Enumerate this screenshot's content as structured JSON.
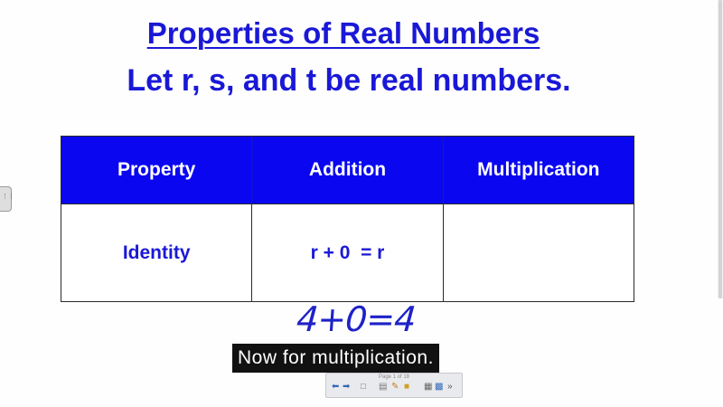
{
  "slide": {
    "title": "Properties of Real Numbers",
    "subtitle": "Let r, s, and t be real numbers."
  },
  "table": {
    "headers": [
      "Property",
      "Addition",
      "Multiplication"
    ],
    "rows": [
      [
        "Identity",
        "r + 0  = r",
        ""
      ]
    ]
  },
  "handwriting": "4+0=4",
  "caption": "Now for multiplication.",
  "toolbar": {
    "page_label": "Page 1 of 18",
    "icons": [
      "back-arrow-icon",
      "forward-arrow-icon",
      "page-icon",
      "table-icon",
      "pen-icon",
      "note-icon",
      "view-icon",
      "screen-icon",
      "more-icon"
    ]
  },
  "colors": {
    "title_blue": "#1a18d6",
    "header_blue": "#0a07f0",
    "handwriting_blue": "#1e22c8"
  }
}
